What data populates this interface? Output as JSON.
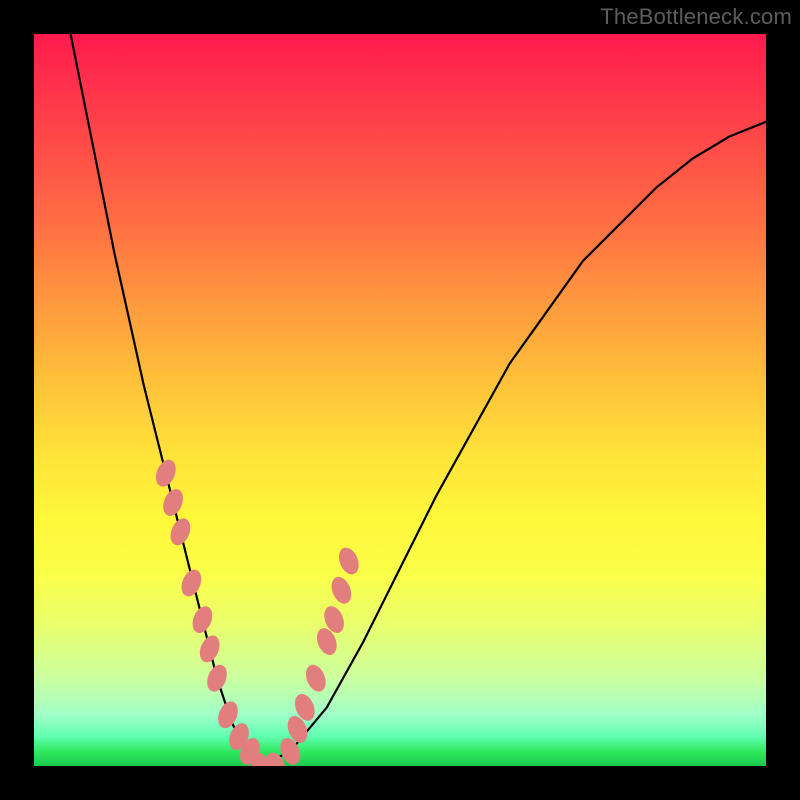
{
  "watermark": "TheBottleneck.com",
  "colors": {
    "frame": "#000000",
    "curve": "#000000",
    "blob": "#e27e7e",
    "gradient_top": "#ff1a4d",
    "gradient_bottom": "#1bca4e"
  },
  "chart_data": {
    "type": "line",
    "title": "",
    "xlabel": "",
    "ylabel": "",
    "xlim": [
      0,
      100
    ],
    "ylim": [
      0,
      100
    ],
    "grid": false,
    "legend": false,
    "series": [
      {
        "name": "bottleneck-curve",
        "x": [
          5,
          7,
          9,
          11,
          13,
          15,
          17,
          19,
          21,
          23,
          25,
          27,
          29,
          31,
          35,
          40,
          45,
          50,
          55,
          60,
          65,
          70,
          75,
          80,
          85,
          90,
          95,
          100
        ],
        "values": [
          100,
          90,
          80,
          70,
          61,
          52,
          44,
          36,
          28,
          20,
          12,
          6,
          2,
          0,
          2,
          8,
          17,
          27,
          37,
          46,
          55,
          62,
          69,
          74,
          79,
          83,
          86,
          88
        ]
      }
    ],
    "annotations": {
      "blobs_x": [
        18,
        19,
        20,
        21.5,
        23,
        24,
        25,
        26.5,
        28,
        29.5,
        31,
        33,
        35,
        36,
        37,
        38.5,
        40,
        41,
        42,
        43
      ],
      "blobs_y": [
        40,
        36,
        32,
        25,
        20,
        16,
        12,
        7,
        4,
        2,
        0,
        0,
        2,
        5,
        8,
        12,
        17,
        20,
        24,
        28
      ]
    }
  }
}
